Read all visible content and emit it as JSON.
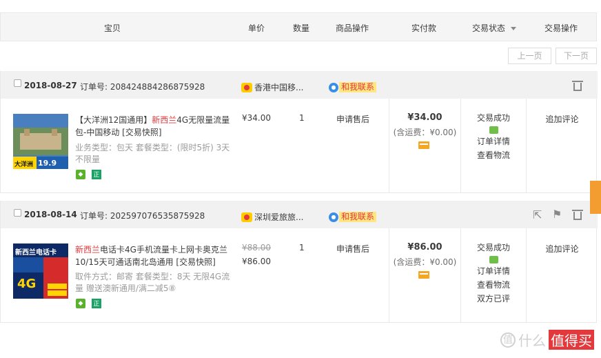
{
  "header": {
    "cols": {
      "item": "宝贝",
      "unit_price": "单价",
      "quantity": "数量",
      "item_ops": "商品操作",
      "paid": "实付款",
      "status": "交易状态",
      "trade_ops": "交易操作"
    }
  },
  "pager": {
    "prev": "上一页",
    "next": "下一页"
  },
  "orders": [
    {
      "date": "2018-08-27",
      "order_no": "订单号: 208424884286875928",
      "shop": "香港中国移...",
      "contact": "和我联系",
      "thumb_label": "大洋洲",
      "thumb_price": "19.9",
      "title_prefix": "【大洋洲12国通用】",
      "title_red": "新西兰",
      "title_rest": "4G无限量流量包-中国移动 [交易快照]",
      "sku": "业务类型：包天   套餐类型：(限时5折) 3天不限量",
      "badge_zheng": "正",
      "price_now": "¥34.00",
      "qty": "1",
      "after_sale": "申请售后",
      "paid": "¥34.00",
      "ship": "(含运费：¥0.00)",
      "status_lines": [
        "交易成功",
        "订单详情",
        "查看物流"
      ],
      "op": "追加评论"
    },
    {
      "date": "2018-08-14",
      "order_no": "订单号: 202597076535875928",
      "shop": "深圳爱旅旅...",
      "contact": "和我联系",
      "thumb_label": "新西兰电话卡",
      "thumb_sub": "4G",
      "title_red": "新西兰",
      "title_rest": "电话卡4G手机流量卡上网卡奥克兰10/15天可通话南北岛通用 [交易快照]",
      "sku": "取件方式：邮寄   套餐类型：8天 无限4G流量 赠送澳新通用/满二减5⑧",
      "badge_zheng": "正",
      "price_old": "¥88.00",
      "price_now": "¥86.00",
      "qty": "1",
      "after_sale": "申请售后",
      "paid": "¥86.00",
      "ship": "(含运费：¥0.00)",
      "status_lines": [
        "交易成功",
        "订单详情",
        "查看物流",
        "双方已评"
      ],
      "op": "追加评论"
    }
  ],
  "watermark": {
    "text": "什么",
    "red": "值得买"
  }
}
